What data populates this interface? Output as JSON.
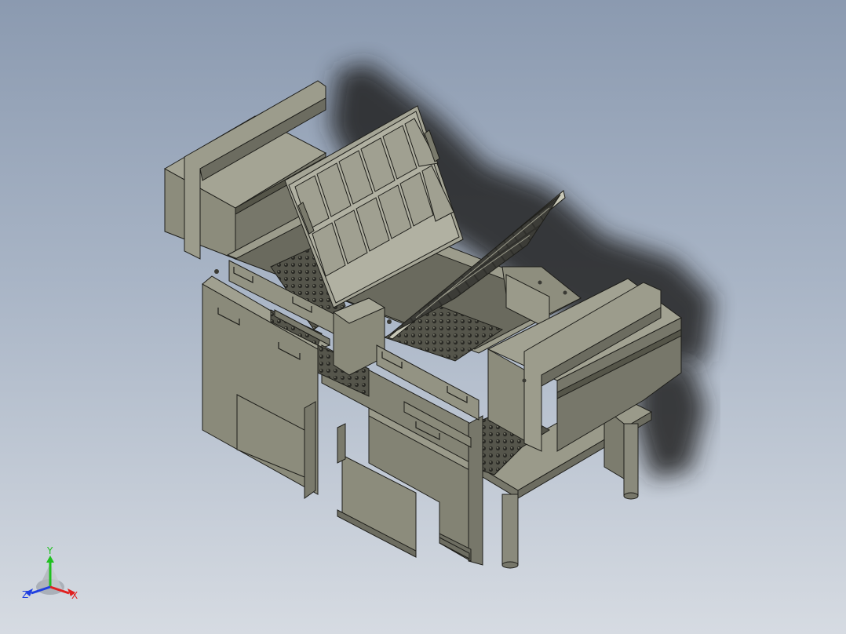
{
  "viewport": {
    "background_top": "#8b9ab0",
    "background_bottom": "#d6dbe2",
    "model_color": "#8c8c7c",
    "model_dark": "#6f6f62",
    "model_light": "#a2a292",
    "edge_color": "#1e1e1a"
  },
  "triad": {
    "x_label": "X",
    "y_label": "Y",
    "z_label": "Z",
    "x_color": "#e02020",
    "y_color": "#20c020",
    "z_color": "#2040e0"
  }
}
